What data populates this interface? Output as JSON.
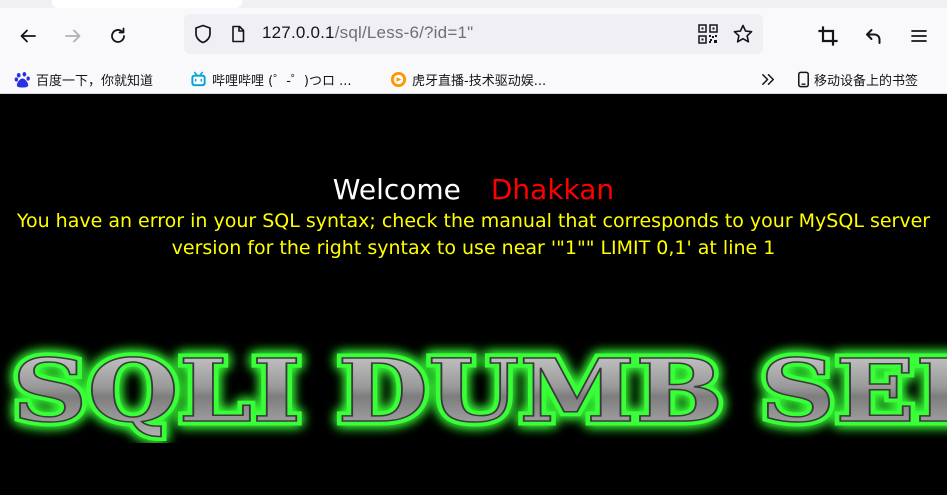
{
  "browser": {
    "url_host": "127.0.0.1",
    "url_path": "/sql/Less-6/?id=1\"",
    "icons": {
      "back": "back-arrow-icon",
      "forward": "forward-arrow-icon",
      "reload": "reload-icon",
      "shield": "tracking-shield-icon",
      "page": "page-info-icon",
      "qr": "qr-code-icon",
      "star": "bookmark-star-icon",
      "crop": "screenshot-crop-icon",
      "undo": "undo-arrow-icon",
      "menu": "hamburger-menu-icon"
    }
  },
  "bookmarks": {
    "items": [
      {
        "label": "百度一下，你就知道",
        "icon": "baidu-paw-icon"
      },
      {
        "label": "哔哩哔哩 (゜-゜)つロ ...",
        "icon": "bilibili-tv-icon"
      },
      {
        "label": "虎牙直播-技术驱动娱...",
        "icon": "huya-icon"
      }
    ],
    "overflow_icon": "chevrons-right-icon",
    "mobile_label": "移动设备上的书签",
    "mobile_icon": "mobile-phone-icon"
  },
  "page": {
    "welcome": "Welcome",
    "name": "Dhakkan",
    "error_line1": "You have an error in your SQL syntax; check the manual that corresponds to your MySQL server",
    "error_line2": "version for the right syntax to use near '\"1\"\" LIMIT 0,1' at line 1",
    "banner_text": "SQLI DUMB SER",
    "colors": {
      "background": "#000000",
      "welcome": "#ffffff",
      "name": "#ff0000",
      "error": "#ffff00",
      "banner_glow": "#2bff2b"
    }
  }
}
